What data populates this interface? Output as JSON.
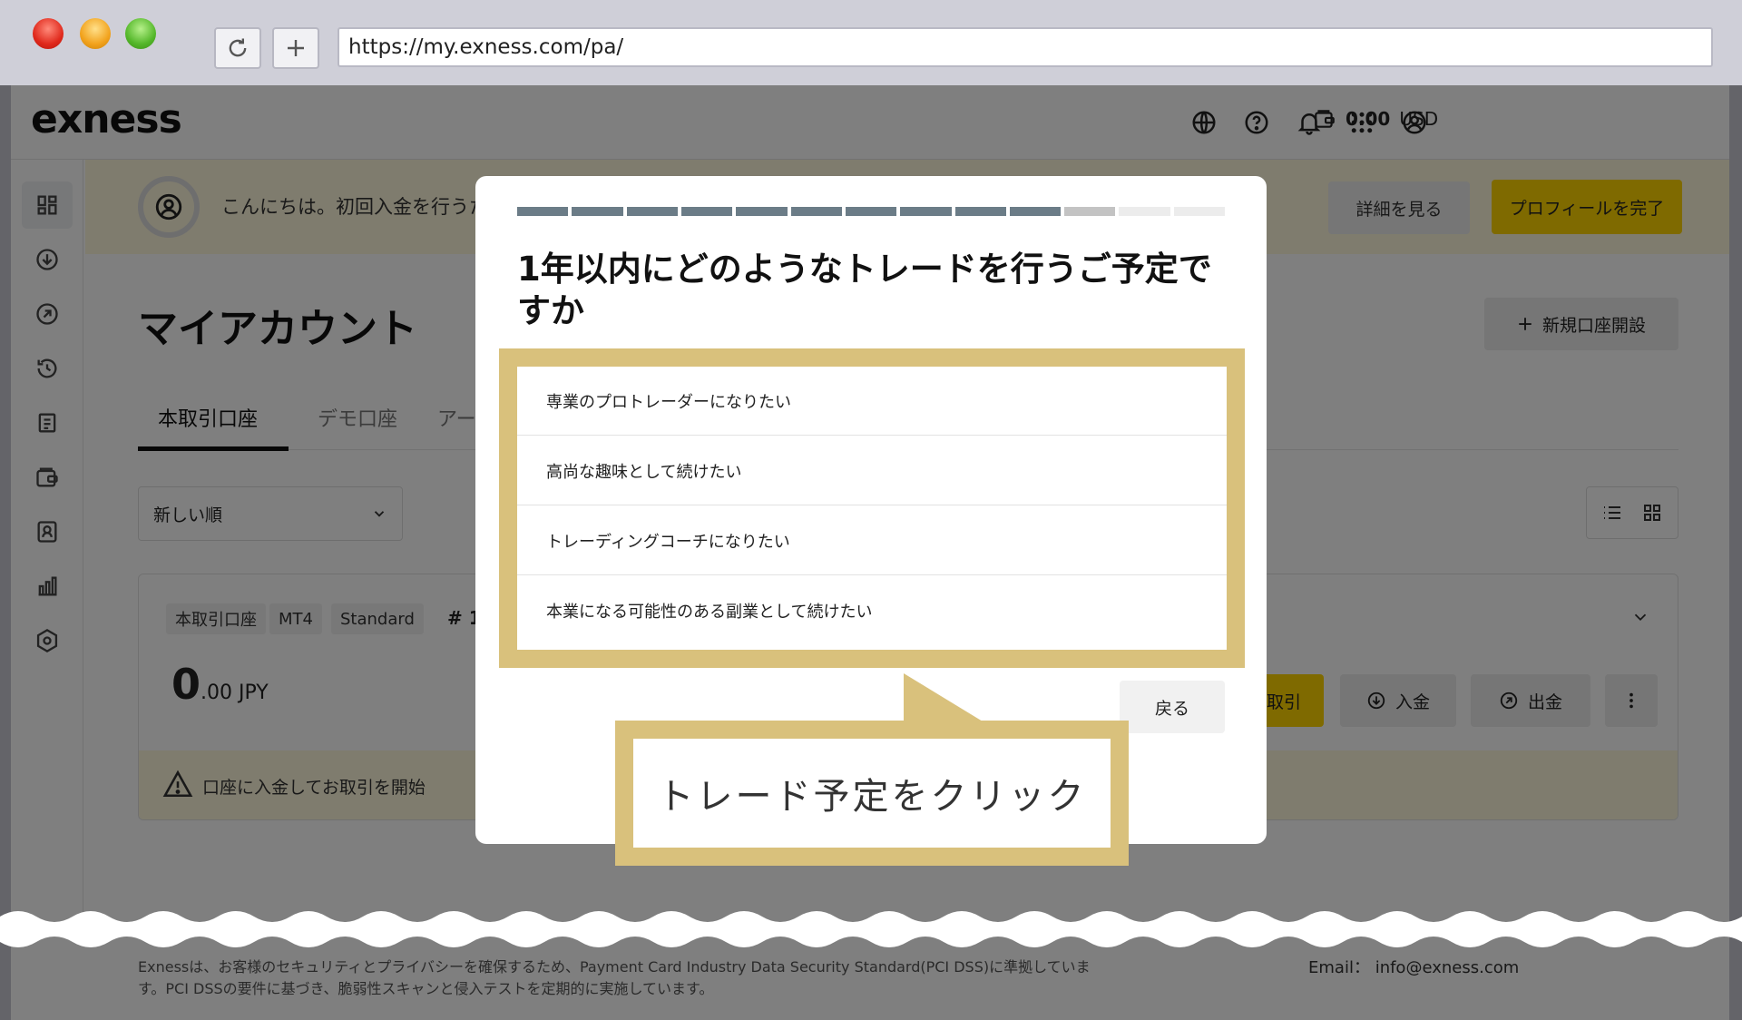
{
  "browser": {
    "url": "https://my.exness.com/pa/",
    "reload_icon": "reload-icon",
    "newtab_icon": "plus-icon"
  },
  "header": {
    "logo": "exness",
    "balance_amount": "0.00",
    "balance_currency": "USD",
    "icons": [
      "wallet-icon",
      "globe-icon",
      "help-icon",
      "bell-icon",
      "apps-grid-icon",
      "user-icon"
    ]
  },
  "sidebar": {
    "icons": [
      "dashboard-icon",
      "deposit-icon",
      "withdraw-icon",
      "history-icon",
      "document-icon",
      "wallet-icon",
      "badge-icon",
      "chart-icon",
      "settings-icon"
    ]
  },
  "banner": {
    "text": "こんにちは。初回入金を行うため",
    "details_label": "詳細を見る",
    "complete_label": "プロフィールを完了"
  },
  "main": {
    "title": "マイアカウント",
    "new_account_label": "新規口座開設",
    "tabs": [
      {
        "label": "本取引口座",
        "active": true
      },
      {
        "label": "デモ口座",
        "active": false
      },
      {
        "label": "アーカ",
        "active": false
      }
    ],
    "sort_value": "新しい順"
  },
  "account_card": {
    "badges": [
      "本取引口座",
      "MT4",
      "Standard"
    ],
    "number": "# 1",
    "balance_int": "0",
    "balance_dec": ".00 JPY",
    "trade_label": "取引",
    "deposit_label": "入金",
    "withdraw_label": "出金",
    "warning_text": "口座に入金してお取引を開始"
  },
  "footer": {
    "text": "Exnessは、お客様のセキュリティとプライバシーを確保するため、Payment Card Industry Data Security Standard(PCI DSS)に準拠しています。PCI DSSの要件に基づき、脆弱性スキャンと侵入テストを定期的に実施しています。",
    "email_label": "Email：",
    "email": "info@exness.com"
  },
  "modal": {
    "progress": {
      "total": 13,
      "completed": 10,
      "current": 11
    },
    "question": "1年以内にどのようなトレードを行うご予定ですか",
    "options": [
      "専業のプロトレーダーになりたい",
      "高尚な趣味として続けたい",
      "トレーディングコーチになりたい",
      "本業になる可能性のある副業として続けたい"
    ],
    "back_label": "戻る"
  },
  "callout": {
    "text": "トレード予定をクリック"
  },
  "colors": {
    "accent_yellow": "#ffd400",
    "highlight_gold": "#d9c17c",
    "progress_done": "#6b7c87",
    "progress_current": "#c3c3c3",
    "progress_todo": "#ececec"
  }
}
